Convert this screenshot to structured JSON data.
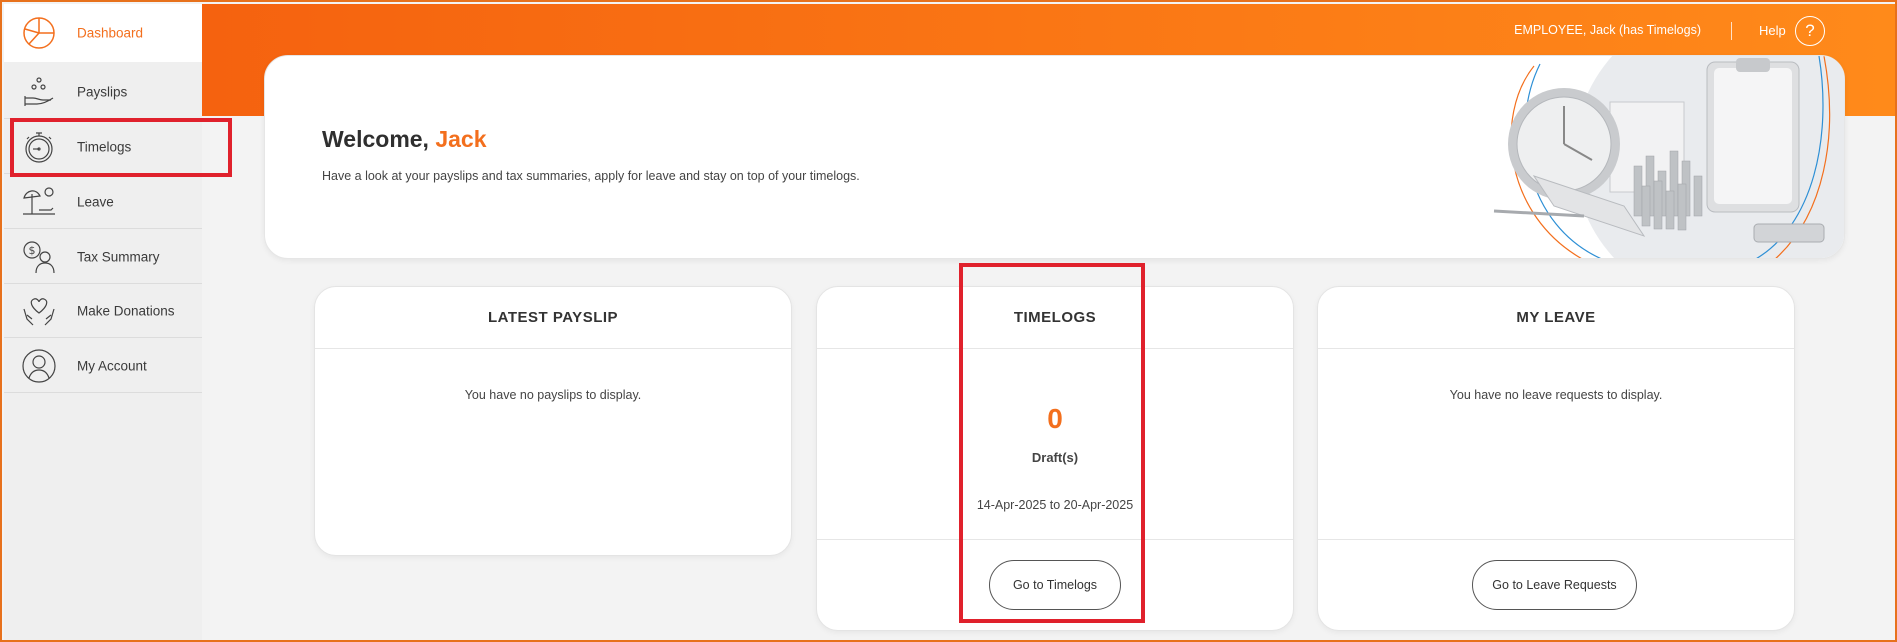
{
  "colors": {
    "accent": "#f36f1d",
    "highlight": "#e0212c"
  },
  "sidebar": {
    "items": [
      {
        "label": "Dashboard",
        "icon": "dashboard-pie-icon",
        "active": true
      },
      {
        "label": "Payslips",
        "icon": "payslips-hand-coins-icon"
      },
      {
        "label": "Timelogs",
        "icon": "stopwatch-icon"
      },
      {
        "label": "Leave",
        "icon": "beach-umbrella-icon"
      },
      {
        "label": "Tax Summary",
        "icon": "tax-person-dollar-icon"
      },
      {
        "label": "Make Donations",
        "icon": "heart-hands-icon"
      },
      {
        "label": "My Account",
        "icon": "user-avatar-icon"
      }
    ]
  },
  "header": {
    "user": "EMPLOYEE, Jack (has Timelogs)",
    "help_label": "Help",
    "help_icon_glyph": "?"
  },
  "welcome": {
    "greeting": "Welcome,",
    "name": "Jack",
    "subtitle": "Have a look at your payslips and tax summaries, apply for leave and stay on top of your timelogs."
  },
  "cards": {
    "payslip": {
      "title": "LATEST PAYSLIP",
      "empty": "You have no payslips to display."
    },
    "timelogs": {
      "title": "TIMELOGS",
      "count": "0",
      "count_label": "Draft(s)",
      "range": "14-Apr-2025 to 20-Apr-2025",
      "button": "Go to Timelogs"
    },
    "leave": {
      "title": "MY LEAVE",
      "empty": "You have no leave requests to display.",
      "button": "Go to Leave Requests"
    }
  }
}
